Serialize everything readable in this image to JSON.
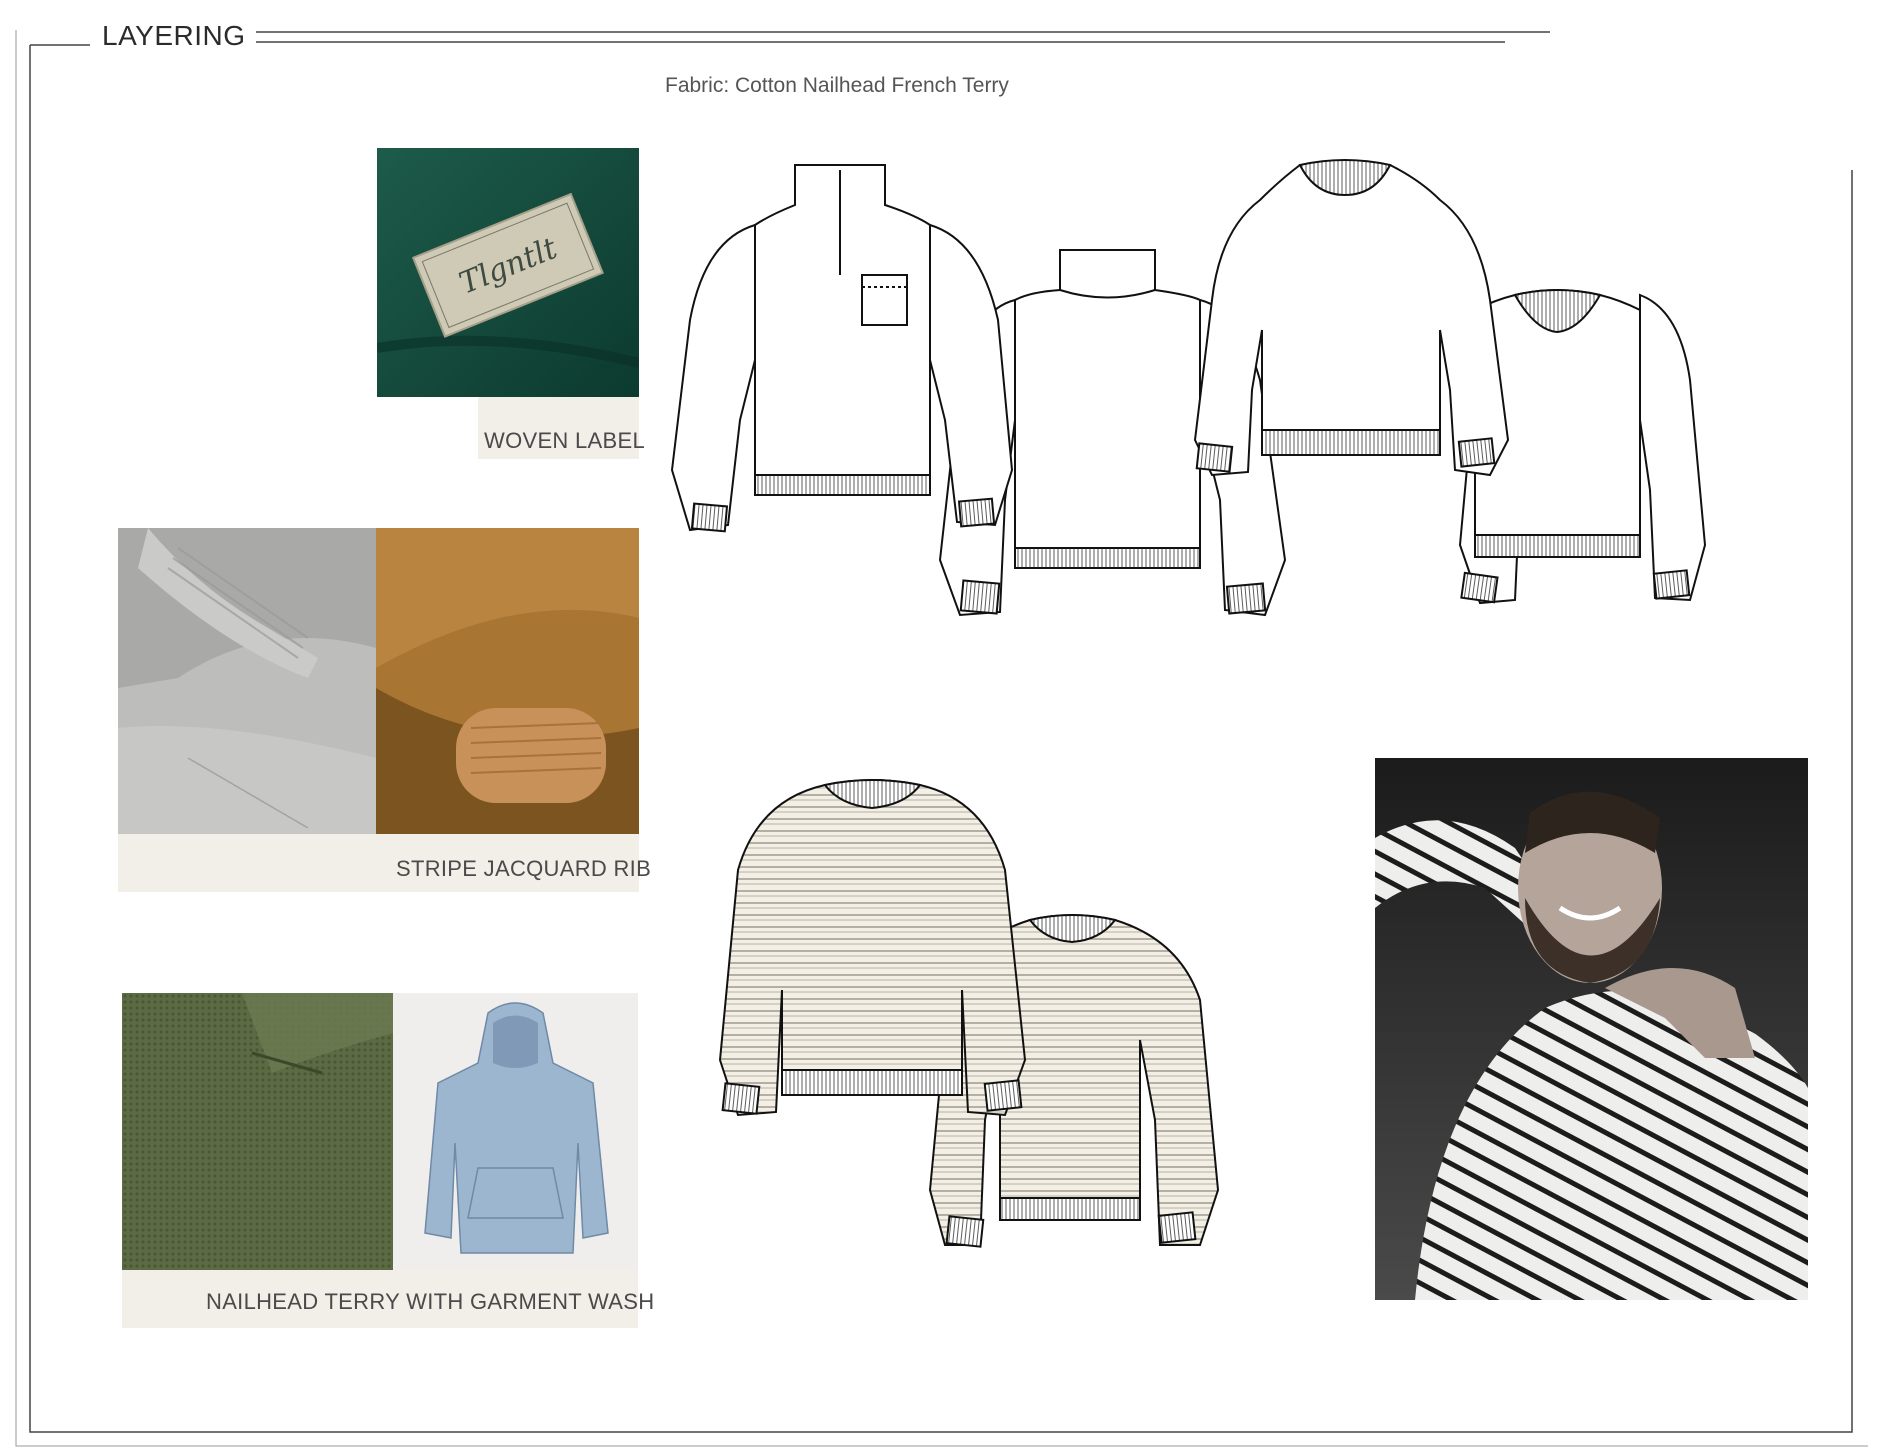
{
  "page": {
    "title": "LAYERING",
    "subtitle": "Fabric: Cotton Nailhead French Terry"
  },
  "swatches": [
    {
      "caption": "WOVEN LABEL",
      "label_text": "Tlgntlt"
    },
    {
      "caption": "STRIPE JACQUARD RIB"
    },
    {
      "caption": "NAILHEAD TERRY WITH GARMENT WASH"
    }
  ],
  "colors": {
    "label_green": "#134a3c",
    "grey_knit": "#b9b9b7",
    "camel_suede": "#a87532",
    "olive_terry": "#5d6b44",
    "washed_blue": "#9db6d0",
    "caption_panel": "#f2efe9"
  },
  "sketches": [
    {
      "name": "quarter-zip-front"
    },
    {
      "name": "quarter-zip-back"
    },
    {
      "name": "crewneck-front"
    },
    {
      "name": "crewneck-back"
    },
    {
      "name": "striped-crewneck-front"
    },
    {
      "name": "striped-crewneck-back"
    }
  ]
}
